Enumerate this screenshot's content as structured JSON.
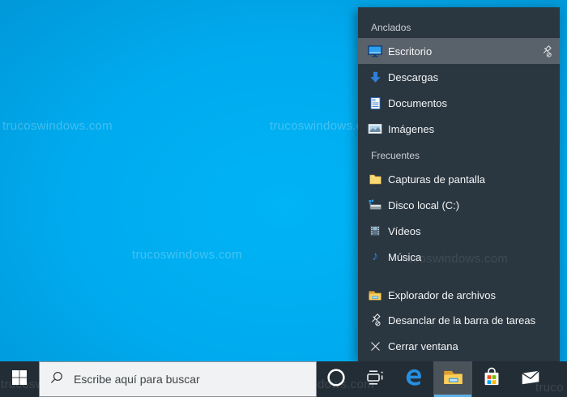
{
  "desktop": {
    "watermark_full": "trucoswindows.com",
    "watermark_part_panel": "ucoswindows.com",
    "watermark_part_bar_left": "trucosw",
    "watermark_part_bar_mid": "dows.com",
    "watermark_part_bar_right": "truco"
  },
  "jumplist": {
    "pinned_header": "Anclados",
    "frequent_header": "Frecuentes",
    "selected_item": "Escritorio",
    "pinned": [
      {
        "label": "Escritorio",
        "icon": "desktop-icon",
        "selected": true
      },
      {
        "label": "Descargas",
        "icon": "download-icon",
        "selected": false
      },
      {
        "label": "Documentos",
        "icon": "document-icon",
        "selected": false
      },
      {
        "label": "Imágenes",
        "icon": "pictures-icon",
        "selected": false
      }
    ],
    "frequent": [
      {
        "label": "Capturas de pantalla",
        "icon": "folder-icon"
      },
      {
        "label": "Disco local (C:)",
        "icon": "disk-icon"
      },
      {
        "label": "Vídeos",
        "icon": "video-icon"
      },
      {
        "label": "Música",
        "icon": "music-icon"
      }
    ],
    "tasks": [
      {
        "label": "Explorador de archivos",
        "icon": "file-explorer-icon"
      },
      {
        "label": "Desanclar de la barra de tareas",
        "icon": "unpin-icon"
      },
      {
        "label": "Cerrar ventana",
        "icon": "close-icon"
      }
    ]
  },
  "taskbar": {
    "search_placeholder": "Escribe aquí para buscar",
    "buttons": [
      "start",
      "search",
      "cortana",
      "task-view",
      "edge",
      "file-explorer",
      "store",
      "mail"
    ],
    "active_button": "file-explorer"
  },
  "colors": {
    "desktop_blue": "#00aaee",
    "panel_bg": "#2a3640",
    "panel_selected": "#59626a",
    "taskbar_bg": "#232d36",
    "accent_underline": "#5fb0e6",
    "ms_red": "#f25022",
    "ms_green": "#7fba00",
    "ms_blue": "#00a4ef",
    "ms_yellow": "#ffb900"
  }
}
